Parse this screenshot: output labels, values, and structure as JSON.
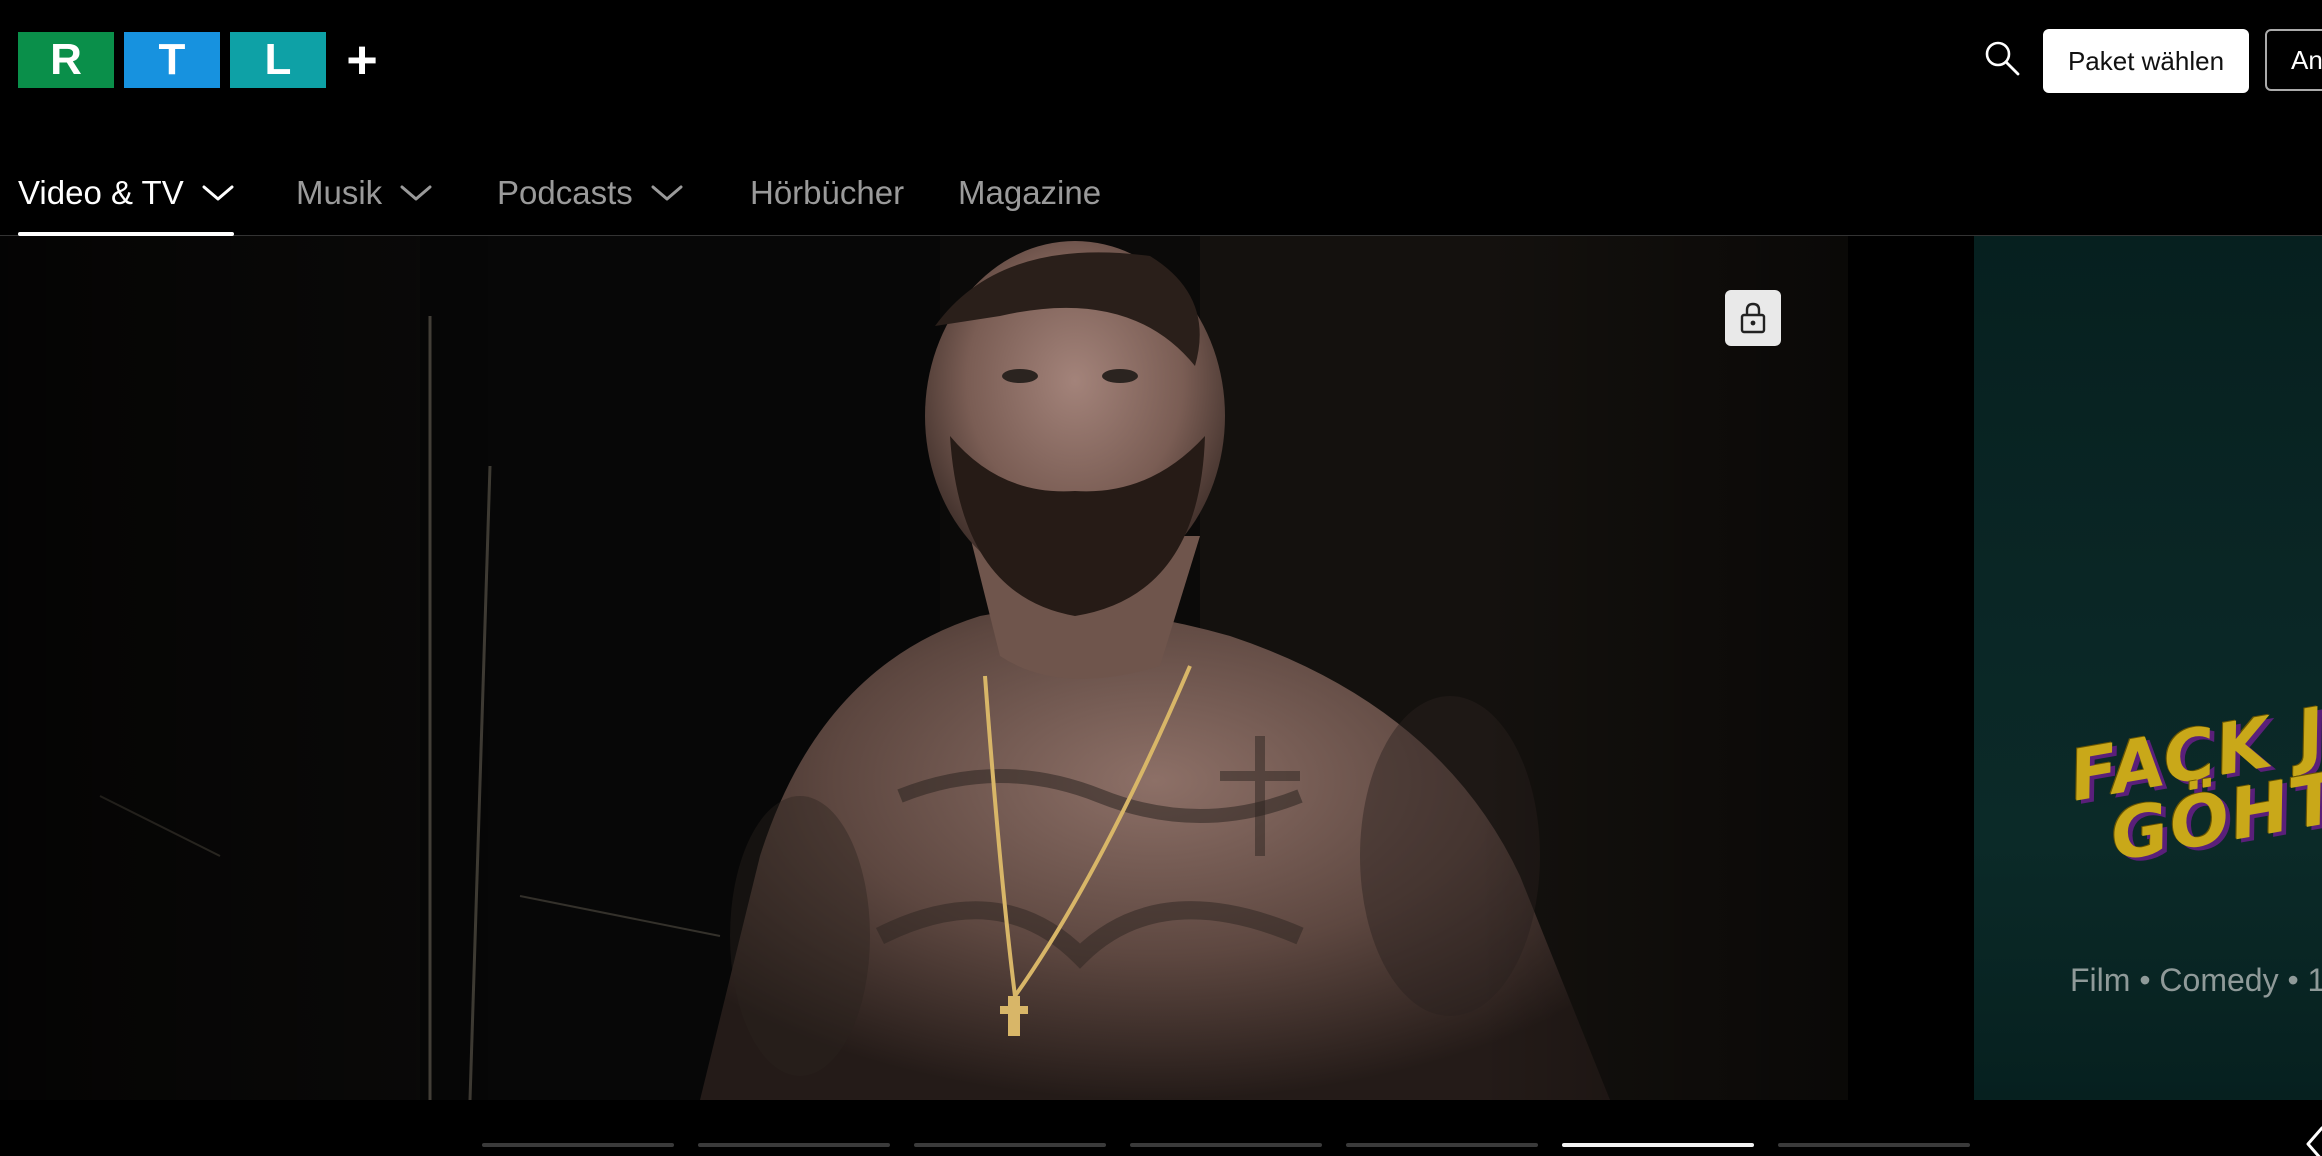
{
  "header": {
    "logo": {
      "letters": [
        "R",
        "T",
        "L"
      ],
      "plus": "+",
      "colors": [
        "#0a8f4a",
        "#1792df",
        "#0ea1a6"
      ]
    },
    "search_icon": "search-icon",
    "package_button": "Paket wählen",
    "login_button": "An"
  },
  "nav": {
    "items": [
      {
        "label": "Video & TV",
        "active": true,
        "dropdown": true
      },
      {
        "label": "Musik",
        "active": false,
        "dropdown": true
      },
      {
        "label": "Podcasts",
        "active": false,
        "dropdown": true
      },
      {
        "label": "Hörbücher",
        "active": false,
        "dropdown": false
      },
      {
        "label": "Magazine",
        "active": false,
        "dropdown": false
      }
    ]
  },
  "hero": {
    "lock_icon": "lock-icon",
    "next_slide": {
      "title_art": [
        "FACK JU",
        "GÖHTE"
      ],
      "meta": "Film • Comedy • 1"
    }
  },
  "pager": {
    "count": 7,
    "active_index": 5,
    "prev_icon": "chevron-left-icon"
  }
}
